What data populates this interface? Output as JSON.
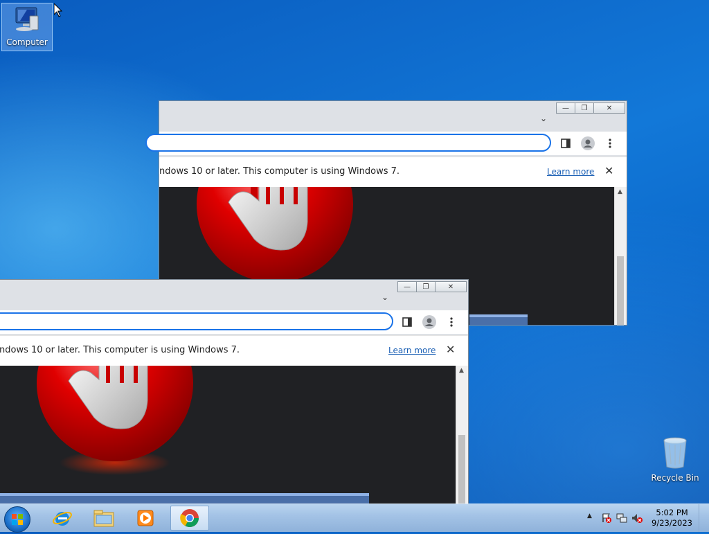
{
  "desktop": {
    "computer_label": "Computer",
    "recycle_label": "Recycle Bin"
  },
  "window_back": {
    "infobar_message": "ndows 10 or later. This computer is using Windows 7.",
    "learn_more": "Learn more",
    "close_x": "✕",
    "chevron": "⌄"
  },
  "window_front": {
    "infobar_message": "ndows 10 or later. This computer is using Windows 7.",
    "learn_more": "Learn more",
    "close_x": "✕",
    "chevron": "⌄"
  },
  "caption": {
    "minimize": "—",
    "restore": "❐",
    "close": "✕"
  },
  "taskbar": {
    "pinned": [
      "ie-icon",
      "explorer-icon",
      "media-player-icon",
      "chrome-icon"
    ],
    "active": "chrome-icon",
    "clock_time": "5:02 PM",
    "clock_date": "9/23/2023",
    "tray_arrow": "▲"
  },
  "colors": {
    "accent": "#1a73e8",
    "link": "#1a5fb4",
    "content_bg": "#202124",
    "stop_red": "#d40000"
  }
}
